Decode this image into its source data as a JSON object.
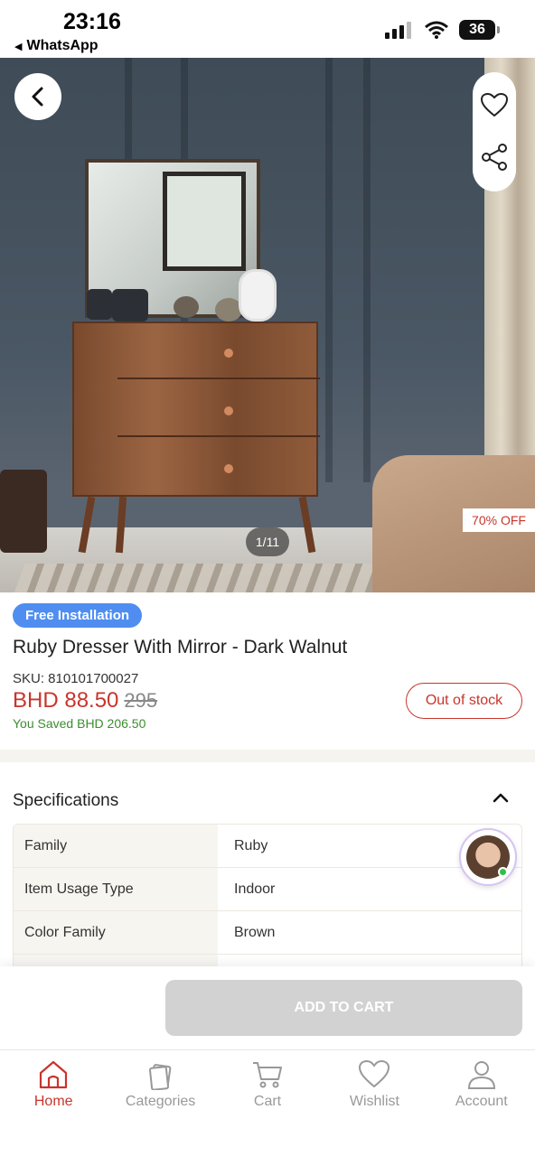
{
  "status_bar": {
    "time": "23:16",
    "back_app": "WhatsApp",
    "battery": "36"
  },
  "gallery": {
    "counter": "1/11",
    "discount": "70% OFF"
  },
  "product": {
    "badge": "Free Installation",
    "title": "Ruby Dresser With Mirror - Dark Walnut",
    "sku": "SKU: 810101700027",
    "price": "BHD 88.50",
    "old_price": "295",
    "saved": "You Saved BHD 206.50",
    "stock_status": "Out of stock"
  },
  "specifications": {
    "heading": "Specifications",
    "rows": [
      {
        "key": "Family",
        "value": "Ruby"
      },
      {
        "key": "Item Usage Type",
        "value": "Indoor"
      },
      {
        "key": "Color Family",
        "value": "Brown"
      }
    ]
  },
  "actions": {
    "add_to_cart": "ADD TO CART"
  },
  "tabbar": {
    "items": [
      {
        "label": "Home",
        "icon": "home-icon"
      },
      {
        "label": "Categories",
        "icon": "categories-icon"
      },
      {
        "label": "Cart",
        "icon": "cart-icon"
      },
      {
        "label": "Wishlist",
        "icon": "heart-icon"
      },
      {
        "label": "Account",
        "icon": "user-icon"
      }
    ]
  },
  "colors": {
    "accent": "#c8352b",
    "badge_blue": "#4f8ef0",
    "saved_green": "#3c8d2f",
    "disabled_button": "#d2d2d2"
  }
}
